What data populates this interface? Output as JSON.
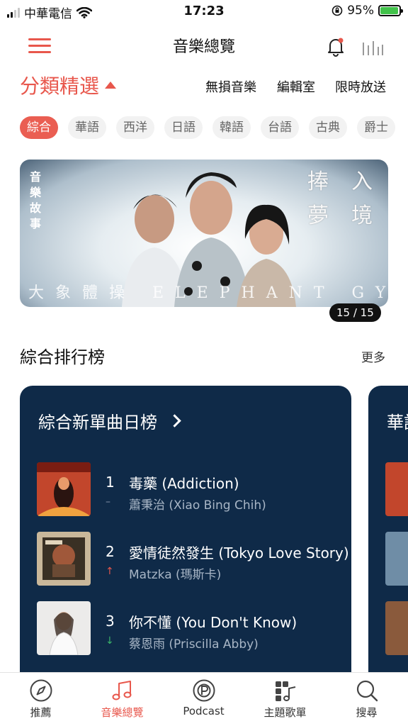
{
  "status": {
    "carrier": "中華電信",
    "time": "17:23",
    "battery": "95%",
    "battery_level": 0.95
  },
  "header": {
    "title": "音樂總覽"
  },
  "category": {
    "main": "分類精選",
    "links": [
      "無損音樂",
      "編輯室",
      "限時放送"
    ],
    "chips": [
      "綜合",
      "華語",
      "西洋",
      "日語",
      "韓語",
      "台語",
      "古典",
      "爵士"
    ],
    "active_chip": 0
  },
  "banner": {
    "left_label": "音樂故事",
    "right_title_col1": "捧夢",
    "right_title_col2": "入境",
    "bottom_text": "大象體操 ELEPHANT GYM",
    "counter": "15 / 15"
  },
  "section": {
    "title": "綜合排行榜",
    "more": "更多"
  },
  "chart_card": {
    "title": "綜合新單曲日榜",
    "tracks": [
      {
        "rank": "1",
        "trend": "–",
        "trend_color": "#7f8fa3",
        "title": "毒藥 (Addiction)",
        "artist": "蕭秉治 (Xiao Bing Chih)"
      },
      {
        "rank": "2",
        "trend": "↑",
        "trend_color": "#e8574c",
        "title": "愛情徒然發生 (Tokyo Love Story)",
        "artist": "Matzka (瑪斯卡)"
      },
      {
        "rank": "3",
        "trend": "↓",
        "trend_color": "#3bb56a",
        "title": "你不懂 (You Don't Know)",
        "artist": "蔡恩雨 (Priscilla Abby)"
      }
    ]
  },
  "chart_card_2": {
    "title": "華語"
  },
  "tabbar": {
    "tabs": [
      "推薦",
      "音樂總覽",
      "Podcast",
      "主題歌單",
      "搜尋"
    ],
    "active": 1
  },
  "colors": {
    "accent": "#e8574c",
    "card_bg": "#0f2a48"
  }
}
